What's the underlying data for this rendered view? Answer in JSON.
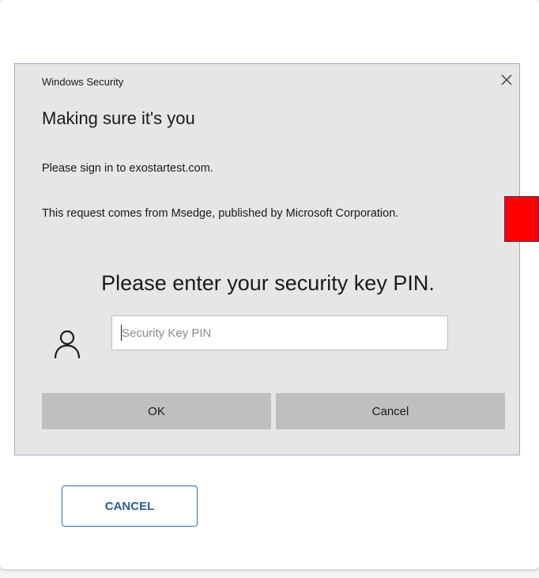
{
  "dialog": {
    "titlebar": "Windows Security",
    "heading": "Making sure it's you",
    "line1": "Please sign in to exostartest.com.",
    "line2": "This request comes from Msedge, published by Microsoft Corporation.",
    "prompt": "Please enter your security key PIN.",
    "pin_input": {
      "value": "",
      "placeholder": "Security Key PIN"
    },
    "ok_label": "OK",
    "cancel_label": "Cancel",
    "icons": {
      "close": "close-icon",
      "user": "person-icon"
    }
  },
  "page": {
    "cancel_label": "CANCEL"
  },
  "colors": {
    "dialog_bg": "#e6e6e6",
    "button_bg": "#bfbfbf",
    "page_cancel_text": "#2c5d90",
    "page_cancel_border": "#2f6fa8",
    "marker": "#ff0000"
  }
}
